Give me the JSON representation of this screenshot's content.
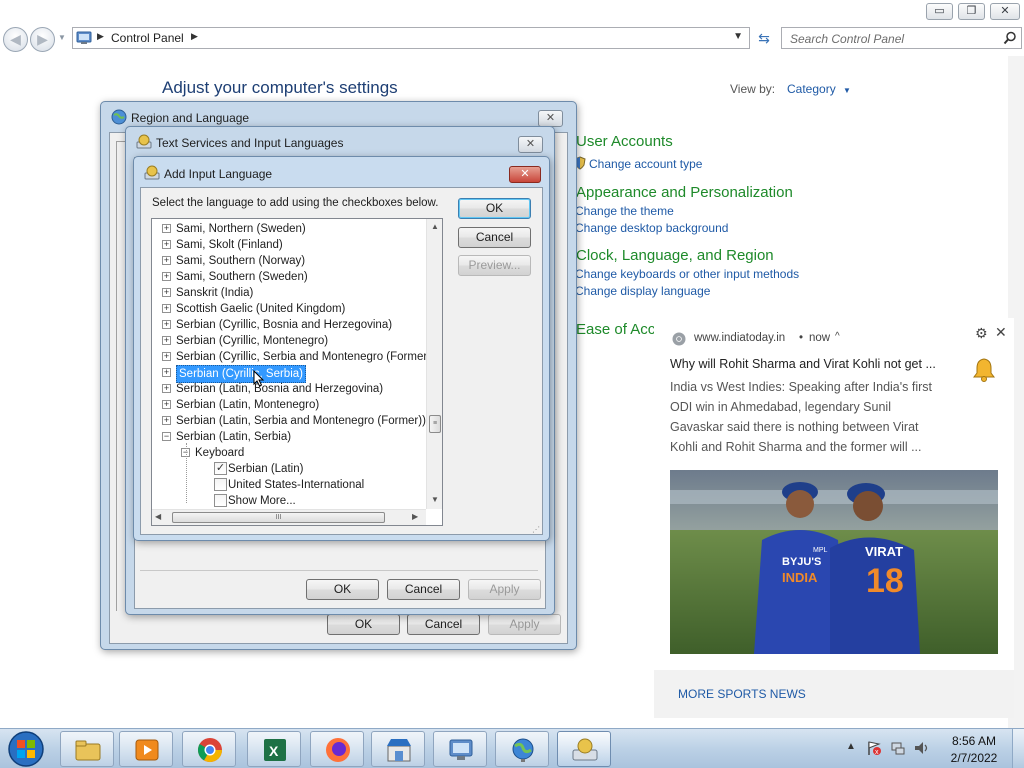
{
  "explorer": {
    "window_controls": {
      "minimize": "▭",
      "maximize": "❐",
      "close": "✕"
    },
    "breadcrumb": "Control Panel",
    "search_placeholder": "Search Control Panel"
  },
  "control_panel": {
    "heading": "Adjust your computer's settings",
    "view_by_label": "View by:",
    "view_by_value": "Category",
    "categories": [
      {
        "title": "User Accounts",
        "links": [
          "Change account type"
        ]
      },
      {
        "title": "Appearance and Personalization",
        "links": [
          "Change the theme",
          "Change desktop background"
        ]
      },
      {
        "title": "Clock, Language, and Region",
        "links": [
          "Change keyboards or other input methods",
          "Change display language"
        ]
      },
      {
        "title": "Ease of Acce",
        "links": []
      }
    ]
  },
  "region_dialog": {
    "title": "Region and Language",
    "ok": "OK",
    "cancel": "Cancel",
    "apply": "Apply"
  },
  "text_services_dialog": {
    "title": "Text Services and Input Languages",
    "ok": "OK",
    "cancel": "Cancel",
    "apply": "Apply"
  },
  "add_input_dialog": {
    "title": "Add Input Language",
    "instruction": "Select the language to add using the checkboxes below.",
    "ok": "OK",
    "cancel": "Cancel",
    "preview": "Preview...",
    "tree_items": [
      "Sami, Northern (Sweden)",
      "Sami, Skolt (Finland)",
      "Sami, Southern (Norway)",
      "Sami, Southern (Sweden)",
      "Sanskrit (India)",
      "Scottish Gaelic (United Kingdom)",
      "Serbian (Cyrillic, Bosnia and Herzegovina)",
      "Serbian (Cyrillic, Montenegro)",
      "Serbian (Cyrillic, Serbia and Montenegro (Former))",
      "Serbian (Cyrillic, Serbia)",
      "Serbian (Latin, Bosnia and Herzegovina)",
      "Serbian (Latin, Montenegro)",
      "Serbian (Latin, Serbia and Montenegro (Former))",
      "Serbian (Latin, Serbia)"
    ],
    "selected_item": "Serbian (Cyrillic, Serbia)",
    "keyboard_label": "Keyboard",
    "keyboards": [
      {
        "label": "Serbian (Latin)",
        "checked": true
      },
      {
        "label": "United States-International",
        "checked": false
      },
      {
        "label": "Show More...",
        "checked": false
      }
    ],
    "scroll_grip": "III"
  },
  "news": {
    "source": "www.indiatoday.in",
    "time": "now",
    "headline": "Why will Rohit Sharma and Virat Kohli not get ...",
    "summary_lines": [
      "India vs West Indies: Speaking after India's first",
      "ODI win in Ahmedabad, legendary Sunil",
      "Gavaskar said there is nothing between Virat",
      "Kohli and Rohit Sharma and the former will ..."
    ],
    "more": "MORE SPORTS NEWS",
    "photo_text": {
      "jersey_left": "BYJU'S",
      "india": "INDIA",
      "name": "VIRAT",
      "number": "18",
      "brand": "MPL"
    }
  },
  "taskbar": {
    "time": "8:56 AM",
    "date": "2/7/2022",
    "apps": [
      "explorer-icon",
      "media-player-icon",
      "chrome-icon",
      "excel-icon",
      "firefox-icon",
      "store-icon",
      "control-panel-icon",
      "network-globe-icon",
      "keyboard-icon"
    ]
  },
  "colors": {
    "link_blue": "#1f5aa6",
    "category_green": "#1e8a2a",
    "selection_blue": "#3399ff",
    "close_red": "#c8463a"
  }
}
